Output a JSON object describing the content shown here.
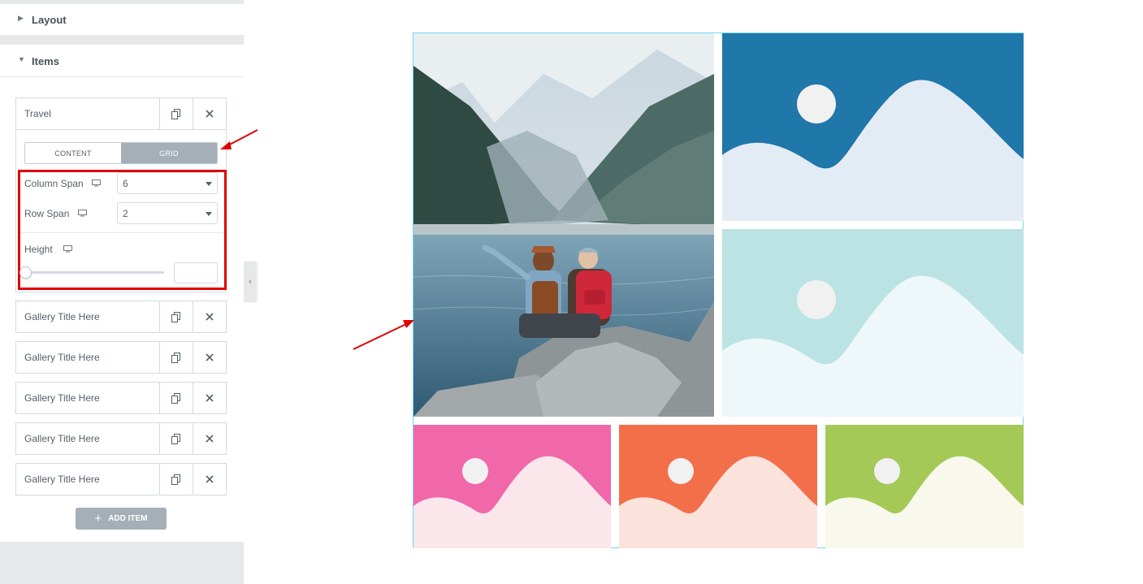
{
  "panel": {
    "sections": {
      "layout": "Layout",
      "items": "Items"
    },
    "repeater_items": [
      {
        "title": "Travel",
        "expanded": true
      },
      {
        "title": "Gallery Title Here"
      },
      {
        "title": "Gallery Title Here"
      },
      {
        "title": "Gallery Title Here"
      },
      {
        "title": "Gallery Title Here"
      },
      {
        "title": "Gallery Title Here"
      }
    ],
    "tabs": {
      "content": "CONTENT",
      "grid": "GRID",
      "active": "GRID"
    },
    "controls": {
      "column_span": {
        "label": "Column Span",
        "value": "6"
      },
      "row_span": {
        "label": "Row Span",
        "value": "2"
      },
      "height": {
        "label": "Height",
        "value": ""
      }
    },
    "add_item_label": "ADD ITEM",
    "icons": {
      "duplicate": "copy-icon",
      "remove": "close-icon",
      "device": "desktop-icon",
      "collapse": "chevron-left-icon",
      "expand": "caret-right-icon",
      "collapse_section": "caret-down-icon"
    }
  },
  "preview": {
    "tiles": [
      {
        "kind": "photo",
        "description_icon": "travel-photo"
      },
      {
        "kind": "placeholder",
        "bg": "#1f77aa",
        "fg": "#e3ecf4"
      },
      {
        "kind": "placeholder",
        "bg": "#bce3e3",
        "fg": "#eef7f9"
      },
      {
        "kind": "placeholder",
        "bg": "#f068aa",
        "fg": "#fbe6ec"
      },
      {
        "kind": "placeholder",
        "bg": "#f26f4a",
        "fg": "#fbe3dc"
      },
      {
        "kind": "placeholder",
        "bg": "#a5c957",
        "fg": "#f8f8ec"
      }
    ],
    "sun_color": "#f1f1f1"
  },
  "colors": {
    "highlight": "#e00000",
    "arrow": "#e00000",
    "accent_border": "#71d7f7"
  }
}
